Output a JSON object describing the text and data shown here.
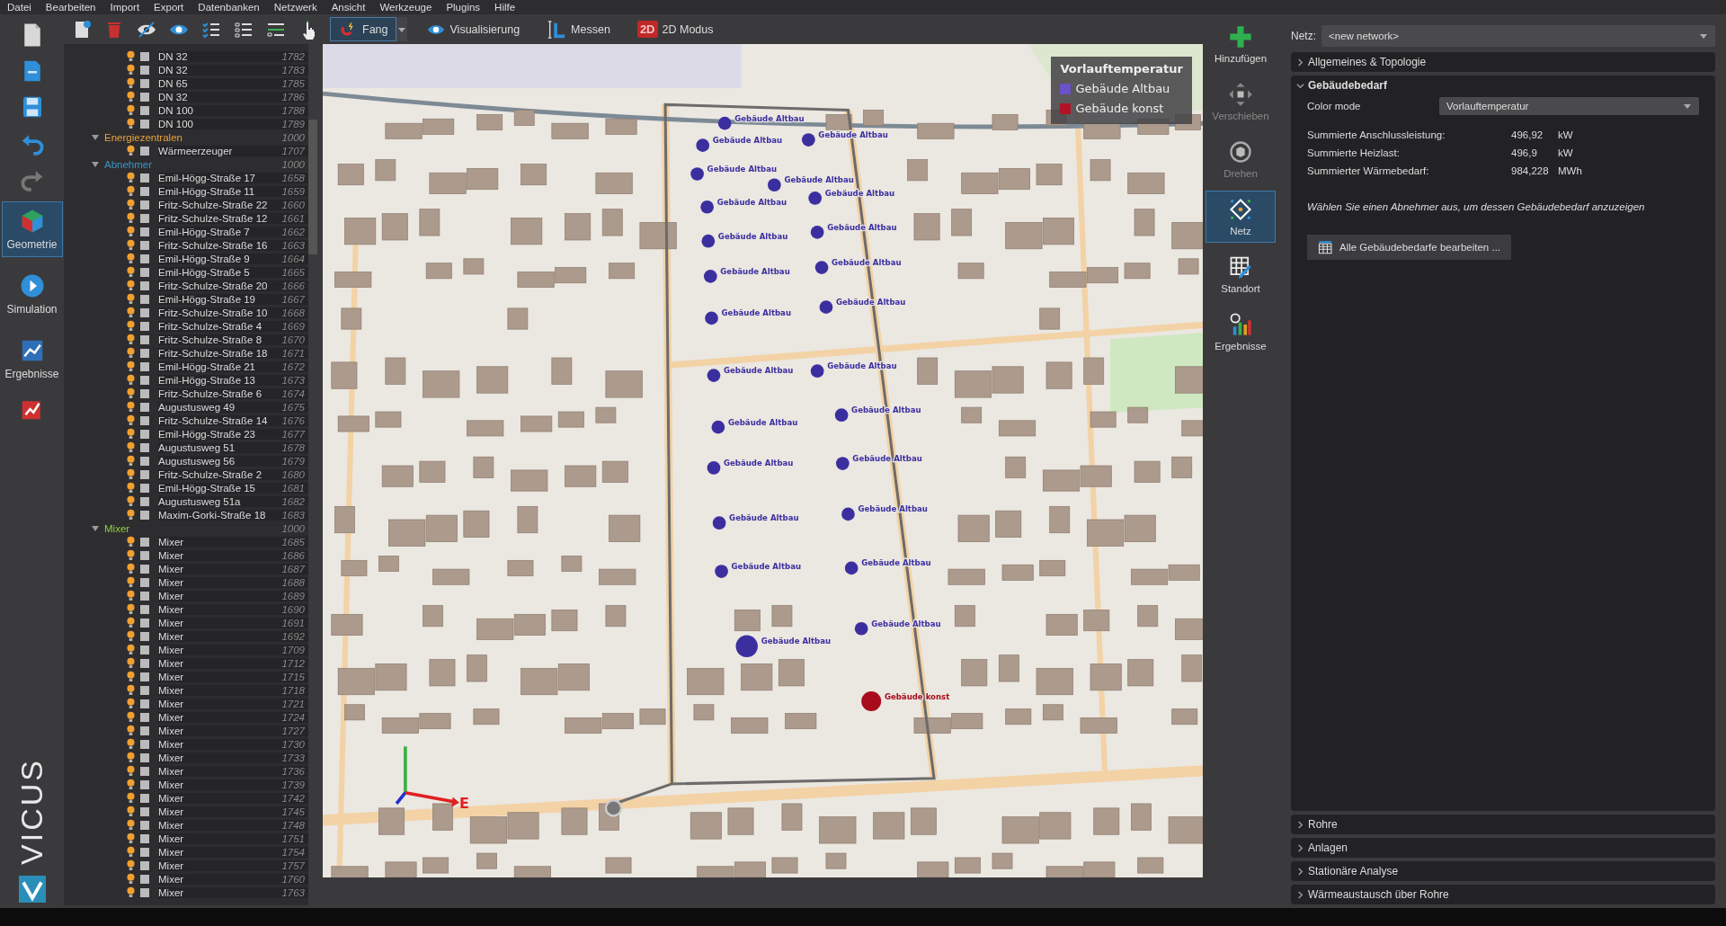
{
  "menu": [
    "Datei",
    "Bearbeiten",
    "Import",
    "Export",
    "Datenbanken",
    "Netzwerk",
    "Ansicht",
    "Werkzeuge",
    "Plugins",
    "Hilfe"
  ],
  "toolbar": {
    "toggles": [
      {
        "label": "Fang",
        "selected": true
      },
      {
        "label": "Visualisierung",
        "selected": false
      },
      {
        "label": "Messen",
        "selected": false
      },
      {
        "label": "2D Modus",
        "badge": "2D",
        "selected": false
      }
    ]
  },
  "modes": [
    {
      "label": "Geometrie",
      "selected": true
    },
    {
      "label": "Simulation",
      "selected": false
    },
    {
      "label": "Ergebnisse",
      "selected": false
    }
  ],
  "brand": "VICUS",
  "tree": {
    "continued_items": [
      {
        "label": "DN 32",
        "number": "1782",
        "checked": false
      },
      {
        "label": "DN 32",
        "number": "1783",
        "checked": false
      },
      {
        "label": "DN 65",
        "number": "1785",
        "checked": false
      },
      {
        "label": "DN 32",
        "number": "1786",
        "checked": false
      },
      {
        "label": "DN 100",
        "number": "1788",
        "checked": false
      },
      {
        "label": "DN 100",
        "number": "1789",
        "checked": false
      }
    ],
    "groups": [
      {
        "label": "Energiezentralen",
        "number": "1000",
        "color": "#e8a33c",
        "expanded": true,
        "children": [
          {
            "label": "Wärmeerzeuger",
            "number": "1707",
            "checked": false
          }
        ]
      },
      {
        "label": "Abnehmer",
        "number": "1000",
        "color": "#3a94c4",
        "expanded": true,
        "children": [
          {
            "label": "Emil-Högg-Straße 17",
            "number": "1658",
            "checked": false
          },
          {
            "label": "Emil-Högg-Straße 11",
            "number": "1659",
            "checked": false
          },
          {
            "label": "Fritz-Schulze-Straße 22",
            "number": "1660",
            "checked": false
          },
          {
            "label": "Fritz-Schulze-Straße 12",
            "number": "1661",
            "checked": false
          },
          {
            "label": "Emil-Högg-Straße 7",
            "number": "1662",
            "checked": false
          },
          {
            "label": "Fritz-Schulze-Straße 16",
            "number": "1663",
            "checked": false
          },
          {
            "label": "Emil-Högg-Straße 9",
            "number": "1664",
            "checked": false
          },
          {
            "label": "Emil-Högg-Straße 5",
            "number": "1665",
            "checked": false
          },
          {
            "label": "Fritz-Schulze-Straße 20",
            "number": "1666",
            "checked": false
          },
          {
            "label": "Emil-Högg-Straße 19",
            "number": "1667",
            "checked": false
          },
          {
            "label": "Fritz-Schulze-Straße 10",
            "number": "1668",
            "checked": false
          },
          {
            "label": "Fritz-Schulze-Straße 4",
            "number": "1669",
            "checked": false
          },
          {
            "label": "Fritz-Schulze-Straße 8",
            "number": "1670",
            "checked": false
          },
          {
            "label": "Fritz-Schulze-Straße 18",
            "number": "1671",
            "checked": false
          },
          {
            "label": "Emil-Högg-Straße 21",
            "number": "1672",
            "checked": false
          },
          {
            "label": "Emil-Högg-Straße 13",
            "number": "1673",
            "checked": false
          },
          {
            "label": "Fritz-Schulze-Straße 6",
            "number": "1674",
            "checked": false
          },
          {
            "label": "Augustusweg 49",
            "number": "1675",
            "checked": false
          },
          {
            "label": "Fritz-Schulze-Straße 14",
            "number": "1676",
            "checked": false
          },
          {
            "label": "Emil-Högg-Straße 23",
            "number": "1677",
            "checked": false
          },
          {
            "label": "Augustusweg 51",
            "number": "1678",
            "checked": false
          },
          {
            "label": "Augustusweg 56",
            "number": "1679",
            "checked": false
          },
          {
            "label": "Fritz-Schulze-Straße 2",
            "number": "1680",
            "checked": false
          },
          {
            "label": "Emil-Högg-Straße 15",
            "number": "1681",
            "checked": false
          },
          {
            "label": "Augustusweg 51a",
            "number": "1682",
            "checked": false
          },
          {
            "label": "Maxim-Gorki-Straße 18",
            "number": "1683",
            "checked": false
          }
        ]
      },
      {
        "label": "Mixer",
        "number": "1000",
        "color": "#8fcf3c",
        "expanded": true,
        "children": [
          {
            "label": "Mixer",
            "number": "1685",
            "checked": false
          },
          {
            "label": "Mixer",
            "number": "1686",
            "checked": false
          },
          {
            "label": "Mixer",
            "number": "1687",
            "checked": false
          },
          {
            "label": "Mixer",
            "number": "1688",
            "checked": false
          },
          {
            "label": "Mixer",
            "number": "1689",
            "checked": false
          },
          {
            "label": "Mixer",
            "number": "1690",
            "checked": false
          },
          {
            "label": "Mixer",
            "number": "1691",
            "checked": false
          },
          {
            "label": "Mixer",
            "number": "1692",
            "checked": false
          },
          {
            "label": "Mixer",
            "number": "1709",
            "checked": false
          },
          {
            "label": "Mixer",
            "number": "1712",
            "checked": false
          },
          {
            "label": "Mixer",
            "number": "1715",
            "checked": false
          },
          {
            "label": "Mixer",
            "number": "1718",
            "checked": false
          },
          {
            "label": "Mixer",
            "number": "1721",
            "checked": false
          },
          {
            "label": "Mixer",
            "number": "1724",
            "checked": false
          },
          {
            "label": "Mixer",
            "number": "1727",
            "checked": false
          },
          {
            "label": "Mixer",
            "number": "1730",
            "checked": false
          },
          {
            "label": "Mixer",
            "number": "1733",
            "checked": false
          },
          {
            "label": "Mixer",
            "number": "1736",
            "checked": false
          },
          {
            "label": "Mixer",
            "number": "1739",
            "checked": false
          },
          {
            "label": "Mixer",
            "number": "1742",
            "checked": false
          },
          {
            "label": "Mixer",
            "number": "1745",
            "checked": false
          },
          {
            "label": "Mixer",
            "number": "1748",
            "checked": false
          },
          {
            "label": "Mixer",
            "number": "1751",
            "checked": false
          },
          {
            "label": "Mixer",
            "number": "1754",
            "checked": false
          },
          {
            "label": "Mixer",
            "number": "1757",
            "checked": false
          },
          {
            "label": "Mixer",
            "number": "1760",
            "checked": false
          },
          {
            "label": "Mixer",
            "number": "1763",
            "checked": false
          }
        ]
      }
    ]
  },
  "map": {
    "legend": {
      "title": "Vorlauftemperatur",
      "items": [
        {
          "label": "Gebäude Altbau",
          "color": "#6a52c8"
        },
        {
          "label": "Gebäude konst",
          "color": "#b01426"
        }
      ]
    },
    "axis_label": "E",
    "consumers": [
      {
        "label": "Gebäude Altbau",
        "color": "#3b2fa0"
      },
      {
        "label": "Gebäude Altbau",
        "color": "#3b2fa0"
      },
      {
        "label": "Gebäude Altbau",
        "color": "#3b2fa0"
      },
      {
        "label": "Gebäude Altbau",
        "color": "#3b2fa0"
      },
      {
        "label": "Gebäude Altbau",
        "color": "#3b2fa0"
      },
      {
        "label": "Gebäude Altbau",
        "color": "#3b2fa0"
      },
      {
        "label": "Gebäude Altbau",
        "color": "#3b2fa0"
      },
      {
        "label": "Gebäude Altbau",
        "color": "#3b2fa0"
      },
      {
        "label": "Gebäude Altbau",
        "color": "#3b2fa0"
      },
      {
        "label": "Gebäude Altbau",
        "color": "#3b2fa0"
      },
      {
        "label": "Gebäude Altbau",
        "color": "#3b2fa0"
      },
      {
        "label": "Gebäude Altbau",
        "color": "#3b2fa0"
      },
      {
        "label": "Gebäude Altbau",
        "color": "#3b2fa0"
      },
      {
        "label": "Gebäude Altbau",
        "color": "#3b2fa0"
      },
      {
        "label": "Gebäude Altbau",
        "color": "#3b2fa0"
      },
      {
        "label": "Gebäude Altbau",
        "color": "#3b2fa0"
      },
      {
        "label": "Gebäude Altbau",
        "color": "#3b2fa0"
      },
      {
        "label": "Gebäude Altbau",
        "color": "#3b2fa0"
      },
      {
        "label": "Gebäude Altbau",
        "color": "#3b2fa0"
      },
      {
        "label": "Gebäude Altbau",
        "color": "#3b2fa0"
      },
      {
        "label": "Gebäude Altbau",
        "color": "#3b2fa0"
      },
      {
        "label": "Gebäude Altbau",
        "color": "#3b2fa0"
      },
      {
        "label": "Gebäude Altbau",
        "color": "#3b2fa0"
      },
      {
        "label": "Gebäude Altbau",
        "color": "#3b2fa0"
      },
      {
        "label": "Gebäude Altbau",
        "color": "#3b2fa0"
      },
      {
        "label": "Gebäude konst",
        "color": "#a80c1c"
      }
    ]
  },
  "tools": [
    {
      "label": "Hinzufügen",
      "selected": false,
      "disabled": false
    },
    {
      "label": "Verschieben",
      "selected": false,
      "disabled": true
    },
    {
      "label": "Drehen",
      "selected": false,
      "disabled": true
    },
    {
      "label": "Netz",
      "selected": true,
      "disabled": false
    },
    {
      "label": "Standort",
      "selected": false,
      "disabled": false
    },
    {
      "label": "Ergebnisse",
      "selected": false,
      "disabled": false
    }
  ],
  "panel": {
    "network_label": "Netz:",
    "network_value": "<new network>",
    "sections": [
      {
        "title": "Allgemeines & Topologie",
        "expanded": false
      },
      {
        "title": "Gebäudebedarf",
        "expanded": true,
        "color_mode_label": "Color mode",
        "color_mode_value": "Vorlauftemperatur",
        "stats": [
          {
            "label": "Summierte Anschlussleistung:",
            "value": "496,92",
            "unit": "kW"
          },
          {
            "label": "Summierte Heizlast:",
            "value": "496,9",
            "unit": "kW"
          },
          {
            "label": "Summierter Wärmebedarf:",
            "value": "984,228",
            "unit": "MWh"
          }
        ],
        "hint": "Wählen Sie einen Abnehmer aus, um dessen Gebäudebedarf anzuzeigen",
        "button": "Alle Gebäudebedarfe bearbeiten ..."
      },
      {
        "title": "Rohre",
        "expanded": false
      },
      {
        "title": "Anlagen",
        "expanded": false
      },
      {
        "title": "Stationäre Analyse",
        "expanded": false
      },
      {
        "title": "Wärmeaustausch über Rohre",
        "expanded": false
      }
    ]
  }
}
